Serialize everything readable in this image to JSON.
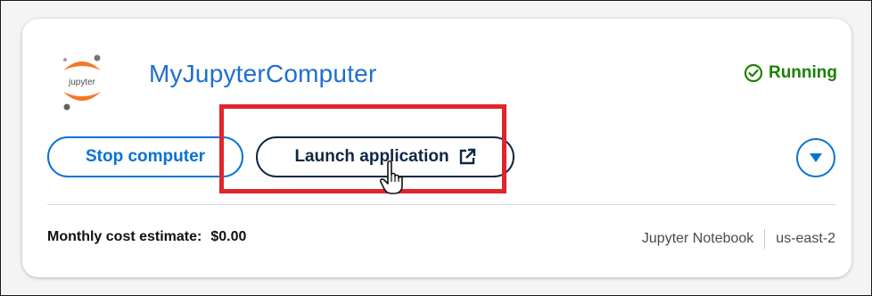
{
  "instance": {
    "name": "MyJupyterComputer",
    "logo_text": "jupyter",
    "status": "Running"
  },
  "actions": {
    "stop_label": "Stop computer",
    "launch_label": "Launch application"
  },
  "footer": {
    "cost_label": "Monthly cost estimate:",
    "cost_value": "$0.00",
    "blueprint": "Jupyter Notebook",
    "region": "us-east-2"
  },
  "colors": {
    "accent": "#0972d3",
    "title": "#1f6fd0",
    "status": "#1d8102",
    "highlight": "#e0252d"
  },
  "icons": {
    "logo": "jupyter-logo-icon",
    "status": "check-circle-icon",
    "launch": "external-link-icon",
    "expand": "caret-down-icon",
    "pointer": "hand-pointer-icon"
  }
}
